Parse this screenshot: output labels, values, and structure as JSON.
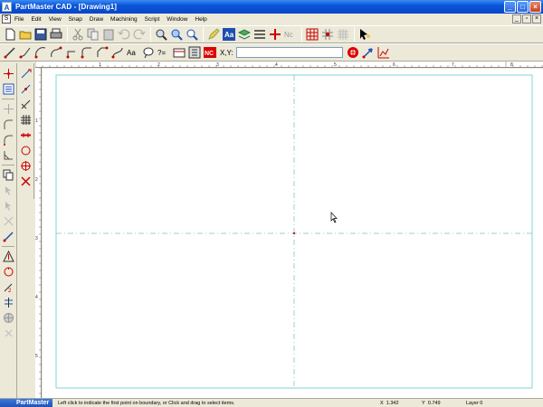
{
  "window": {
    "app_icon": "A",
    "title": "PartMaster CAD - [Drawing1]",
    "minimize_icon": "minimize-icon",
    "maximize_icon": "maximize-icon",
    "close_icon": "close-icon"
  },
  "menu": {
    "items": [
      "File",
      "Edit",
      "View",
      "Snap",
      "Draw",
      "Machining",
      "Script",
      "Window",
      "Help"
    ]
  },
  "toolbar1": {
    "icons": [
      "new-file-icon",
      "open-folder-icon",
      "save-icon",
      "print-icon",
      "cut-icon",
      "copy-icon",
      "paste-icon",
      "undo-icon",
      "redo-icon",
      "zoom-icon",
      "zoom-window-icon",
      "zoom-extents-icon",
      "pencil-icon",
      "text-style-icon",
      "layers-icon",
      "line-style-icon",
      "dimension-icon",
      "nc-icon",
      "grid-snap-icon",
      "snap-point-icon",
      "grid-icon",
      "pointer-icon"
    ],
    "text_style_label": "Aa",
    "nc_label": "Nc"
  },
  "toolbar2": {
    "icons": [
      "line-icon",
      "polyline-icon",
      "arc-icon",
      "arc-2-icon",
      "arc-3-icon",
      "fillet-icon",
      "chamfer-icon",
      "curve-icon",
      "text-icon",
      "balloon-icon",
      "formula-icon",
      "postprocess-icon",
      "gcode-icon",
      "nc-stop-icon",
      "target-icon",
      "arrow-icon",
      "chart-icon"
    ],
    "text_label": "Aa",
    "formula_label": "?=",
    "nc_stop_label": "NC",
    "xy_label": "X,Y:",
    "xy_value": ""
  },
  "sidebar1": {
    "icons": [
      "point-icon",
      "properties-icon",
      "line-tool-icon",
      "arc-tool-icon",
      "fillet-tool-icon",
      "measure-icon",
      "copy-tool-icon",
      "move-icon",
      "select-icon",
      "mirror-icon",
      "trim-icon",
      "hatch-icon",
      "rotate-icon",
      "scale-icon",
      "offset-icon",
      "globe-icon",
      "pan-icon"
    ]
  },
  "sidebar2": {
    "icons": [
      "snap-endpoint-icon",
      "snap-midpoint-icon",
      "snap-nearest-icon",
      "snap-grid-icon",
      "snap-divide-icon",
      "snap-circle-icon",
      "snap-center-icon",
      "snap-intersection-icon"
    ]
  },
  "ruler": {
    "top_labels": [
      "1",
      "2",
      "3",
      "4",
      "5",
      "6",
      "7",
      "8"
    ],
    "left_labels": [
      "1",
      "2",
      "3",
      "4",
      "5"
    ]
  },
  "status": {
    "brand": "PartMaster",
    "message": "Left click to indicate the first point on boundary, or Click and drag to select items.",
    "x_label": "X",
    "x_value": "1.342",
    "y_label": "Y",
    "y_value": "0.749",
    "layer": "Layer 0"
  },
  "colors": {
    "canvas_border": "#7fd6d6",
    "crosshair": "#7fc4c4",
    "origin": "#e00000"
  }
}
